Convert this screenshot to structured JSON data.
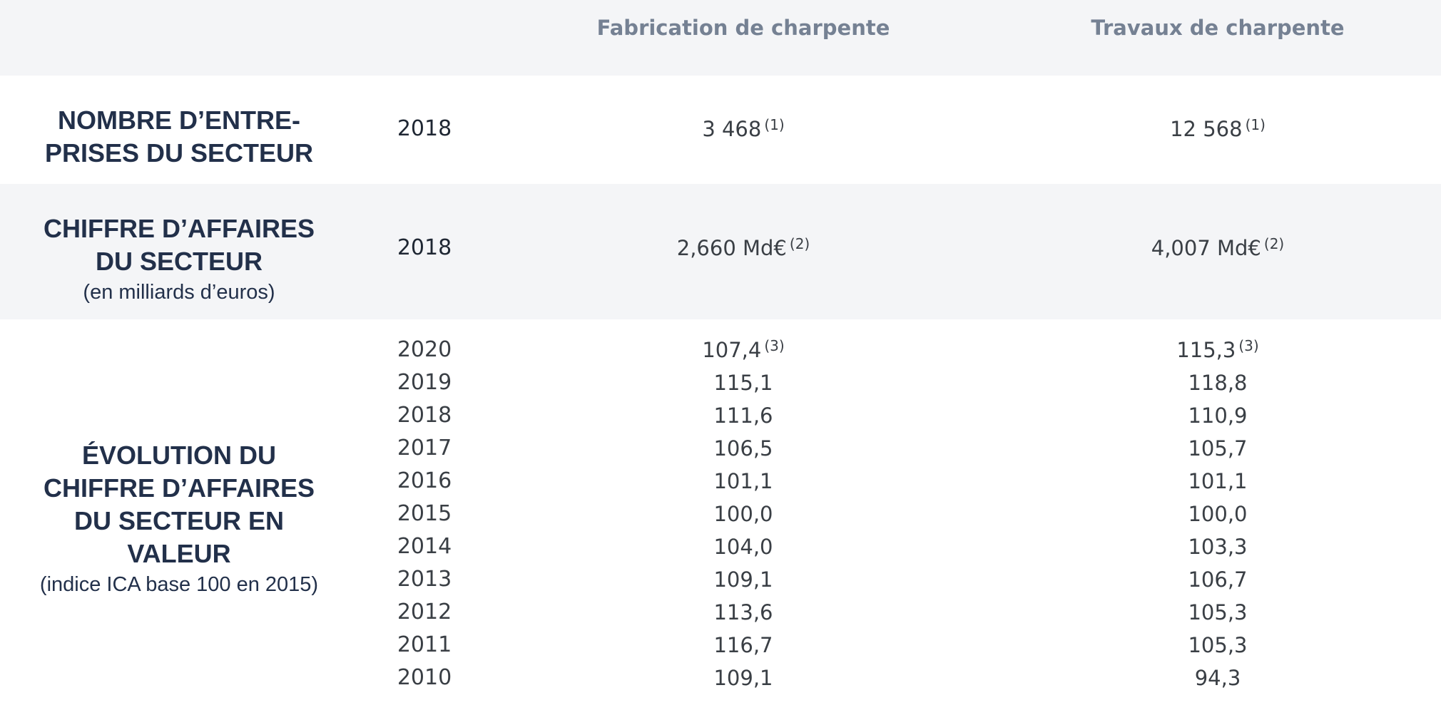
{
  "columns": {
    "col1": "Fabrication de charpente",
    "col2": "Travaux de charpente"
  },
  "sections": {
    "entreprises": {
      "title_line1": "NOMBRE D’ENTRE-",
      "title_line2": "PRISES DU SECTEUR",
      "year": "2018",
      "col1_value": "3 468",
      "col1_note": "(1)",
      "col2_value": "12 568",
      "col2_note": "(1)"
    },
    "chiffre_affaires": {
      "title_line1": "CHIFFRE D’AFFAIRES",
      "title_line2": "DU SECTEUR",
      "subtitle": "(en milliards d’euros)",
      "year": "2018",
      "col1_value": "2,660 Md€",
      "col1_note": "(2)",
      "col2_value": "4,007 Md€",
      "col2_note": "(2)"
    },
    "evolution": {
      "title_line1": "ÉVOLUTION DU",
      "title_line2": "CHIFFRE D’AFFAIRES",
      "title_line3": "DU SECTEUR EN",
      "title_line4": "VALEUR",
      "subtitle": "(indice ICA base 100 en 2015)",
      "rows": [
        {
          "year": "2020",
          "col1": "107,4",
          "col1_note": "(3)",
          "col2": "115,3",
          "col2_note": "(3)"
        },
        {
          "year": "2019",
          "col1": "115,1",
          "col2": "118,8"
        },
        {
          "year": "2018",
          "col1": "111,6",
          "col2": "110,9"
        },
        {
          "year": "2017",
          "col1": "106,5",
          "col2": "105,7"
        },
        {
          "year": "2016",
          "col1": "101,1",
          "col2": "101,1"
        },
        {
          "year": "2015",
          "col1": "100,0",
          "col2": "100,0"
        },
        {
          "year": "2014",
          "col1": "104,0",
          "col2": "103,3"
        },
        {
          "year": "2013",
          "col1": "109,1",
          "col2": "106,7"
        },
        {
          "year": "2012",
          "col1": "113,6",
          "col2": "105,3"
        },
        {
          "year": "2011",
          "col1": "116,7",
          "col2": "105,3"
        },
        {
          "year": "2010",
          "col1": "109,1",
          "col2": "94,3"
        }
      ]
    }
  }
}
